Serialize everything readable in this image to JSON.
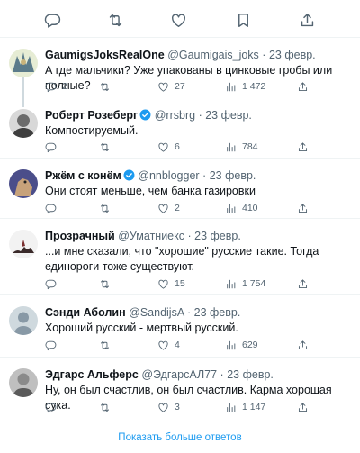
{
  "tweets": [
    {
      "name": "GaumigsJoksRealOne",
      "handle": "@Gaumigais_joks",
      "date": "23 февр.",
      "text": "А где мальчики? Уже упакованы в цинковые гробы или полные?",
      "replies": "2",
      "retweets": "",
      "likes": "27",
      "views": "1 472"
    },
    {
      "name": "Роберт Розеберг",
      "handle": "@rrsbrg",
      "date": "23 февр.",
      "text": "Компостируемый.",
      "replies": "",
      "retweets": "",
      "likes": "6",
      "views": "784"
    },
    {
      "name": "Ржём с конём",
      "handle": "@nnblogger",
      "date": "23 февр.",
      "text": "Они стоят меньше, чем банка газировки",
      "replies": "",
      "retweets": "",
      "likes": "2",
      "views": "410"
    },
    {
      "name": "Прозрачный",
      "handle": "@Уматниекс",
      "date": "23 февр.",
      "text": "...и мне сказали, что \"хорошие\" русские такие. Тогда единороги тоже существуют.",
      "replies": "",
      "retweets": "",
      "likes": "15",
      "views": "1 754"
    },
    {
      "name": "Сэнди Аболин",
      "handle": "@SandijsA",
      "date": "23 февр.",
      "text": "Хороший русский - мертвый русский.",
      "replies": "",
      "retweets": "",
      "likes": "4",
      "views": "629"
    },
    {
      "name": "Эдгарс Альферс",
      "handle": "@ЭдгарсАЛ77",
      "date": "23 февр.",
      "text": "Ну, он был счастлив, он был счастлив. Карма хорошая сука.",
      "replies": "",
      "retweets": "",
      "likes": "3",
      "views": "1 147"
    }
  ],
  "show_more": "Показать больше ответов",
  "separator": "·",
  "colors": {
    "accent": "#1d9bf0",
    "text": "#0f1419",
    "muted": "#536471",
    "border": "#eff3f4"
  }
}
